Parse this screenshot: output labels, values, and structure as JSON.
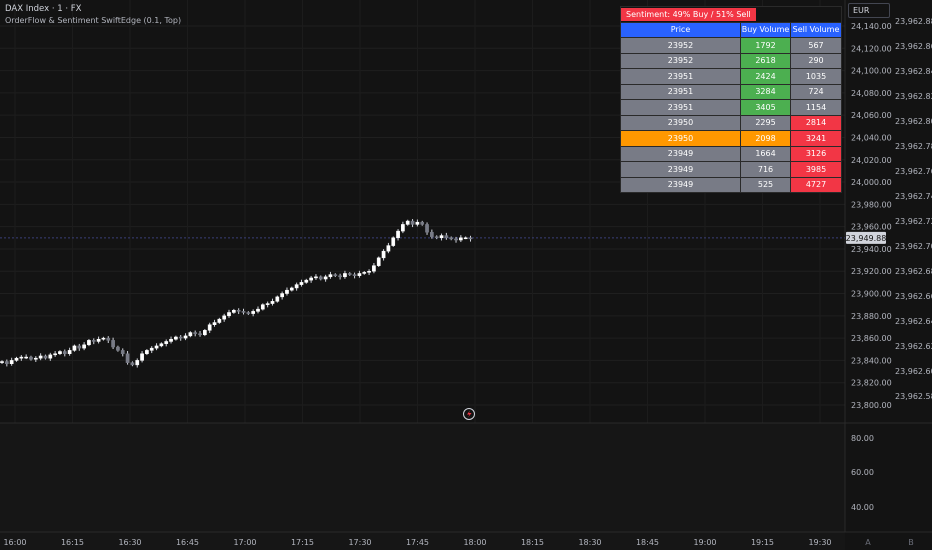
{
  "header": {
    "title": "DAX Index · 1 · FX",
    "indicator": "OrderFlow & Sentiment SwiftEdge (0.1, Top)"
  },
  "currency": "EUR",
  "sentiment": "Sentiment: 49% Buy / 51% Sell",
  "table": {
    "headers": [
      "Price",
      "Buy Volume",
      "Sell Volume"
    ],
    "rows": [
      {
        "price": "23952",
        "buy": "1792",
        "sell": "567"
      },
      {
        "price": "23952",
        "buy": "2618",
        "sell": "290"
      },
      {
        "price": "23951",
        "buy": "2424",
        "sell": "1035"
      },
      {
        "price": "23951",
        "buy": "3284",
        "sell": "724"
      },
      {
        "price": "23951",
        "buy": "3405",
        "sell": "1154"
      },
      {
        "price": "23950",
        "buy": "2295",
        "sell": "2814"
      },
      {
        "price": "23950",
        "buy": "2098",
        "sell": "3241"
      },
      {
        "price": "23949",
        "buy": "1664",
        "sell": "3126"
      },
      {
        "price": "23949",
        "buy": "716",
        "sell": "3985"
      },
      {
        "price": "23949",
        "buy": "525",
        "sell": "4727"
      }
    ]
  },
  "colors": {
    "background": "#131313",
    "gray": "#787b86",
    "green": "#4caf50",
    "red": "#f23645",
    "orange": "#ff9800",
    "header_blue": "#2962ff"
  },
  "chart_data": {
    "type": "candlestick",
    "price_ticks": [
      "24,140.00",
      "24,120.00",
      "24,100.00",
      "24,080.00",
      "24,060.00",
      "24,040.00",
      "24,020.00",
      "24,000.00",
      "23,980.00",
      "23,960.00",
      "23,940.00",
      "23,920.00",
      "23,900.00",
      "23,880.00",
      "23,860.00",
      "23,840.00",
      "23,820.00",
      "23,800.00"
    ],
    "second_axis_ticks": [
      "23,962.88",
      "23,962.86",
      "23,962.84",
      "23,962.82",
      "23,962.80",
      "23,962.78",
      "23,962.76",
      "23,962.74",
      "23,962.72",
      "23,962.70",
      "23,962.68",
      "23,962.66",
      "23,962.64",
      "23,962.62",
      "23,962.60",
      "23,962.58"
    ],
    "current_price": "23,949.88",
    "lower_pane_ticks": [
      "80.00",
      "60.00",
      "40.00"
    ],
    "time_ticks": [
      "16:00",
      "16:15",
      "16:30",
      "16:45",
      "17:00",
      "17:15",
      "17:30",
      "17:45",
      "18:00",
      "18:15",
      "18:30",
      "18:45",
      "19:00",
      "19:15",
      "19:30"
    ],
    "axis_markers": [
      "A",
      "B"
    ],
    "closes": [
      23839,
      23837,
      23840,
      23842,
      23843,
      23843,
      23841,
      23842,
      23844,
      23842,
      23845,
      23846,
      23848,
      23846,
      23849,
      23853,
      23851,
      23854,
      23858,
      23857,
      23859,
      23860,
      23858,
      23852,
      23849,
      23846,
      23838,
      23836,
      23840,
      23846,
      23849,
      23851,
      23853,
      23855,
      23857,
      23859,
      23861,
      23860,
      23862,
      23865,
      23864,
      23863,
      23867,
      23872,
      23874,
      23877,
      23880,
      23883,
      23885,
      23884,
      23883,
      23882,
      23884,
      23886,
      23890,
      23891,
      23893,
      23897,
      23900,
      23903,
      23905,
      23908,
      23910,
      23912,
      23914,
      23915,
      23913,
      23915,
      23917,
      23916,
      23915,
      23918,
      23917,
      23916,
      23918,
      23919,
      23920,
      23925,
      23932,
      23938,
      23943,
      23950,
      23956,
      23962,
      23965,
      23962,
      23964,
      23962,
      23955,
      23951,
      23950,
      23952,
      23950,
      23949,
      23948,
      23950,
      23950,
      23949
    ]
  }
}
